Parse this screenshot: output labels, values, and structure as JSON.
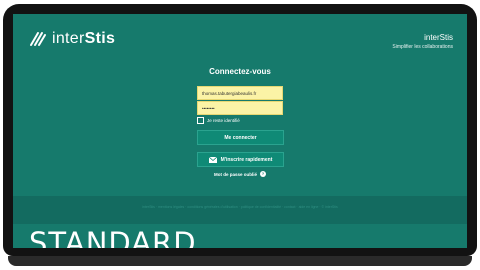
{
  "brand": {
    "logo_prefix": "inter",
    "logo_bold": "Stis"
  },
  "header": {
    "title": "interStis",
    "subtitle": "Simplifier les collaborations"
  },
  "login": {
    "title": "Connectez-vous",
    "email_value": "thomas.tabutergiabeaulis.fr",
    "password_value": "••••••••",
    "remember_label": "Je reste identifié",
    "connect_label": "Me connecter",
    "signup_label": "M'inscrire rapidement",
    "forgot_label": "Mot de passe oublié"
  },
  "footer": {
    "text": "interStis · mentions légales · conditions générales d'utilisation · politique de confidentialité · contact · aide en ligne · © interStis"
  },
  "overlay": {
    "edition_label": "STANDARD"
  },
  "colors": {
    "background": "#167a6c",
    "button": "#0f8a76",
    "field": "#fbf3a6"
  }
}
